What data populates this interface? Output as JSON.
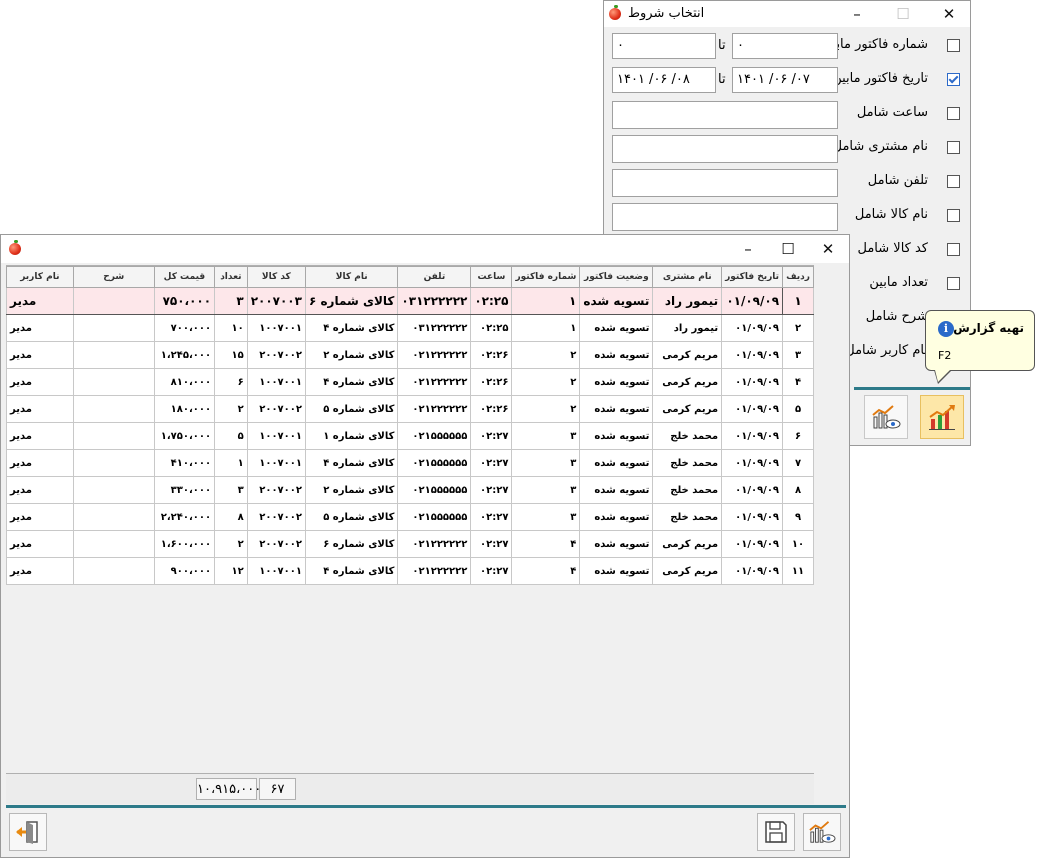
{
  "filter_window": {
    "title": "انتخاب شروط",
    "controls": {
      "minimize": "–",
      "maximize": "☐",
      "close": "✕"
    },
    "to_label": "تا",
    "rows": [
      {
        "label": "شماره فاکتور مابین",
        "checked": false,
        "from": "۰",
        "to": "۰"
      },
      {
        "label": "تاریخ فاکتور مابین",
        "checked": true,
        "from": "۱۴۰۱ /۰۶ /۰۷",
        "to": "۱۴۰۱ /۰۶ /۰۸"
      },
      {
        "label": "ساعت شامل",
        "checked": false,
        "value": ""
      },
      {
        "label": "نام مشتری شامل",
        "checked": false,
        "value": ""
      },
      {
        "label": "تلفن شامل",
        "checked": false,
        "value": ""
      },
      {
        "label": "نام کالا شامل",
        "checked": false,
        "value": ""
      },
      {
        "label": "کد کالا شامل",
        "checked": false
      },
      {
        "label": "تعداد مابین",
        "checked": false
      },
      {
        "label": "شرح شامل",
        "checked": false
      },
      {
        "label": "نام کاربر شامل",
        "checked": false
      }
    ],
    "tool_buttons": [
      {
        "name": "generate-report-button",
        "icon": "chart-up-icon"
      },
      {
        "name": "preview-report-button",
        "icon": "chart-eye-icon"
      }
    ]
  },
  "tooltip": {
    "title": "تهیه گزارش",
    "shortcut": "F2",
    "icon": "info-icon"
  },
  "report_window": {
    "controls": {
      "minimize": "–",
      "maximize": "☐",
      "close": "✕"
    },
    "columns": [
      "ردیف",
      "تاریخ فاکتور",
      "نام مشتری",
      "وضعیت فاکتور",
      "شماره فاکتور",
      "ساعت",
      "تلفن",
      "نام کالا",
      "کد کالا",
      "تعداد",
      "قیمت کل",
      "شرح",
      "نام کاربر"
    ],
    "rows": [
      [
        "۱",
        "۰۱/۰۹/۰۹",
        "تیمور راد",
        "تسویه شده",
        "۱",
        "۰۲:۲۵",
        "۰۳۱۲۲۲۲۲۲",
        "کالای شماره ۶",
        "۲۰۰۷۰۰۳",
        "۳",
        "۷۵۰،۰۰۰",
        "",
        "مدیر"
      ],
      [
        "۲",
        "۰۱/۰۹/۰۹",
        "تیمور راد",
        "تسویه شده",
        "۱",
        "۰۲:۲۵",
        "۰۳۱۲۲۲۲۲۲",
        "کالای شماره ۴",
        "۱۰۰۷۰۰۱",
        "۱۰",
        "۷۰۰،۰۰۰",
        "",
        "مدیر"
      ],
      [
        "۳",
        "۰۱/۰۹/۰۹",
        "مریم کرمی",
        "تسویه شده",
        "۲",
        "۰۲:۲۶",
        "۰۲۱۲۲۲۲۲۲",
        "کالای شماره ۲",
        "۲۰۰۷۰۰۲",
        "۱۵",
        "۱،۲۴۵،۰۰۰",
        "",
        "مدیر"
      ],
      [
        "۴",
        "۰۱/۰۹/۰۹",
        "مریم کرمی",
        "تسویه شده",
        "۲",
        "۰۲:۲۶",
        "۰۲۱۲۲۲۲۲۲",
        "کالای شماره ۴",
        "۱۰۰۷۰۰۱",
        "۶",
        "۸۱۰،۰۰۰",
        "",
        "مدیر"
      ],
      [
        "۵",
        "۰۱/۰۹/۰۹",
        "مریم کرمی",
        "تسویه شده",
        "۲",
        "۰۲:۲۶",
        "۰۲۱۲۲۲۲۲۲",
        "کالای شماره ۵",
        "۲۰۰۷۰۰۲",
        "۲",
        "۱۸۰،۰۰۰",
        "",
        "مدیر"
      ],
      [
        "۶",
        "۰۱/۰۹/۰۹",
        "محمد خلج",
        "تسویه شده",
        "۳",
        "۰۲:۲۷",
        "۰۲۱۵۵۵۵۵۵",
        "کالای شماره ۱",
        "۱۰۰۷۰۰۱",
        "۵",
        "۱،۷۵۰،۰۰۰",
        "",
        "مدیر"
      ],
      [
        "۷",
        "۰۱/۰۹/۰۹",
        "محمد خلج",
        "تسویه شده",
        "۳",
        "۰۲:۲۷",
        "۰۲۱۵۵۵۵۵۵",
        "کالای شماره ۴",
        "۱۰۰۷۰۰۱",
        "۱",
        "۴۱۰،۰۰۰",
        "",
        "مدیر"
      ],
      [
        "۸",
        "۰۱/۰۹/۰۹",
        "محمد خلج",
        "تسویه شده",
        "۳",
        "۰۲:۲۷",
        "۰۲۱۵۵۵۵۵۵",
        "کالای شماره ۲",
        "۲۰۰۷۰۰۲",
        "۳",
        "۳۳۰،۰۰۰",
        "",
        "مدیر"
      ],
      [
        "۹",
        "۰۱/۰۹/۰۹",
        "محمد خلج",
        "تسویه شده",
        "۳",
        "۰۲:۲۷",
        "۰۲۱۵۵۵۵۵۵",
        "کالای شماره ۵",
        "۲۰۰۷۰۰۲",
        "۸",
        "۲،۲۴۰،۰۰۰",
        "",
        "مدیر"
      ],
      [
        "۱۰",
        "۰۱/۰۹/۰۹",
        "مریم کرمی",
        "تسویه شده",
        "۴",
        "۰۲:۲۷",
        "۰۲۱۲۲۲۲۲۲",
        "کالای شماره ۶",
        "۲۰۰۷۰۰۲",
        "۲",
        "۱،۶۰۰،۰۰۰",
        "",
        "مدیر"
      ],
      [
        "۱۱",
        "۰۱/۰۹/۰۹",
        "مریم کرمی",
        "تسویه شده",
        "۴",
        "۰۲:۲۷",
        "۰۲۱۲۲۲۲۲۲",
        "کالای شماره ۴",
        "۱۰۰۷۰۰۱",
        "۱۲",
        "۹۰۰،۰۰۰",
        "",
        "مدیر"
      ]
    ],
    "totals": {
      "count": "۶۷",
      "total_price": "۱۰،۹۱۵،۰۰۰"
    },
    "bottom_buttons": [
      {
        "name": "exit-button",
        "icon": "exit-door-icon"
      },
      {
        "name": "save-button",
        "icon": "floppy-disk-icon"
      },
      {
        "name": "report-preview-button",
        "icon": "chart-eye-icon"
      }
    ]
  }
}
